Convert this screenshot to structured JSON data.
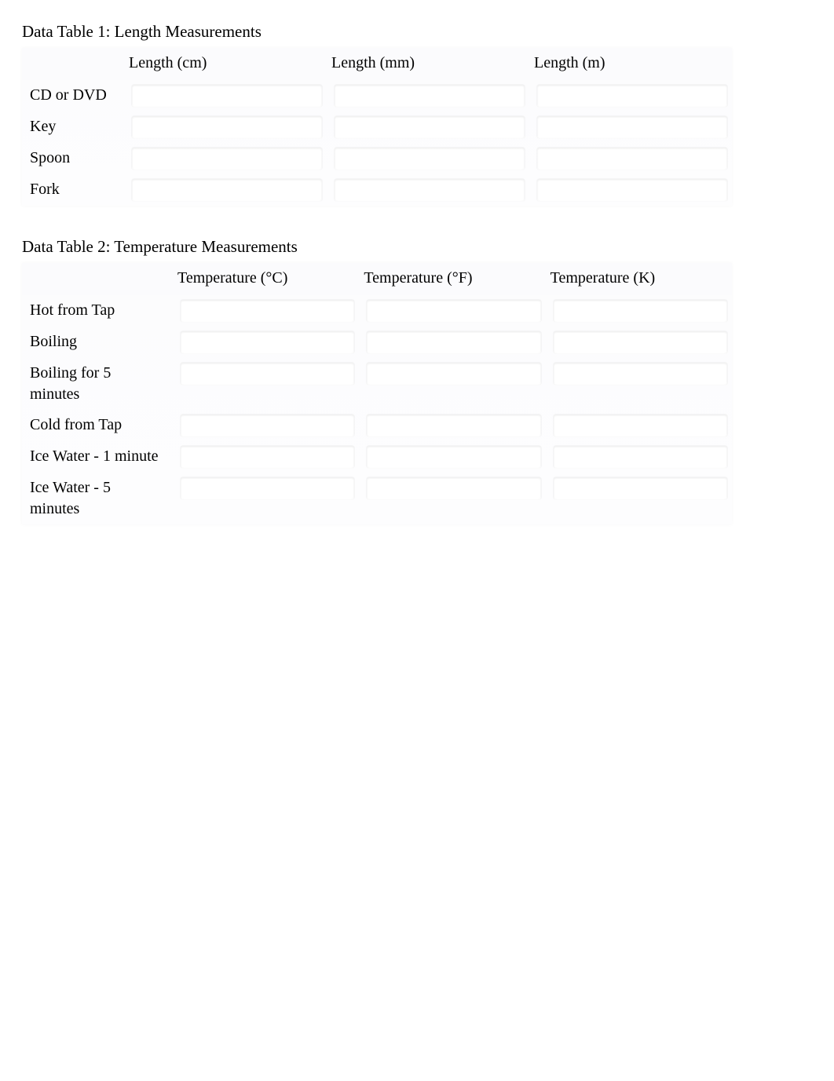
{
  "table1": {
    "title": "Data Table 1: Length Measurements",
    "columns": [
      "Length (cm)",
      "Length (mm)",
      "Length (m)"
    ],
    "rows": [
      {
        "label": "CD or DVD",
        "values": [
          "",
          "",
          ""
        ]
      },
      {
        "label": "Key",
        "values": [
          "",
          "",
          ""
        ]
      },
      {
        "label": "Spoon",
        "values": [
          "",
          "",
          ""
        ]
      },
      {
        "label": "Fork",
        "values": [
          "",
          "",
          ""
        ]
      }
    ]
  },
  "table2": {
    "title": "Data Table 2: Temperature Measurements",
    "columns": [
      "Temperature  (°C)",
      "Temperature  (°F)",
      "Temperature  (K)"
    ],
    "rows": [
      {
        "label": "Hot from Tap",
        "values": [
          "",
          "",
          ""
        ]
      },
      {
        "label": "Boiling",
        "values": [
          "",
          "",
          ""
        ]
      },
      {
        "label": "Boiling for 5 minutes",
        "values": [
          "",
          "",
          ""
        ]
      },
      {
        "label": "Cold from Tap",
        "values": [
          "",
          "",
          ""
        ]
      },
      {
        "label": "Ice Water - 1 minute",
        "values": [
          "",
          "",
          ""
        ]
      },
      {
        "label": "Ice Water - 5 minutes",
        "values": [
          "",
          "",
          ""
        ]
      }
    ]
  }
}
